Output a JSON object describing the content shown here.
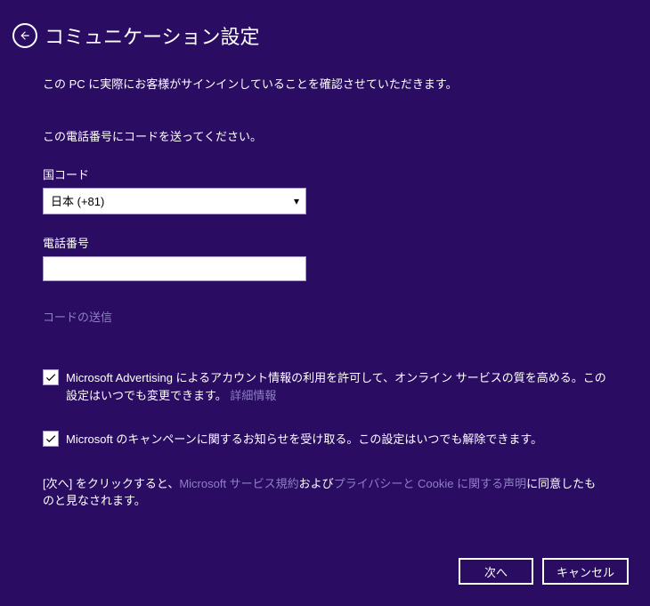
{
  "header": {
    "title": "コミュニケーション設定"
  },
  "intro_text": "この PC に実際にお客様がサインインしていることを確認させていただきます。",
  "send_code_prompt": "この電話番号にコードを送ってください。",
  "country_code": {
    "label": "国コード",
    "selected": "日本 (+81)"
  },
  "phone": {
    "label": "電話番号",
    "value": ""
  },
  "send_code_link": "コードの送信",
  "checkboxes": [
    {
      "checked": true,
      "text_before": "Microsoft Advertising によるアカウント情報の利用を許可して、オンライン サービスの質を高める。この設定はいつでも変更できます。",
      "link_text": "詳細情報"
    },
    {
      "checked": true,
      "text_before": "Microsoft のキャンペーンに関するお知らせを受け取る。この設定はいつでも解除できます。",
      "link_text": ""
    }
  ],
  "agreement": {
    "before": "[次へ] をクリックすると、",
    "link1": "Microsoft サービス規約",
    "mid": "および",
    "link2": "プライバシーと Cookie に関する声明",
    "after": "に同意したものと見なされます。"
  },
  "buttons": {
    "next": "次へ",
    "cancel": "キャンセル"
  }
}
